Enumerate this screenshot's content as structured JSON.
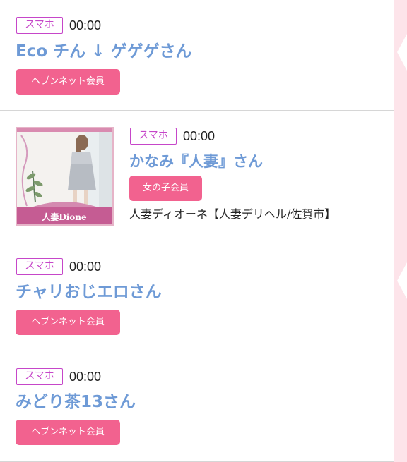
{
  "entries": [
    {
      "device": "スマホ",
      "time": "00:00",
      "name": "Eco チん ↓ ゲゲゲさん",
      "member_type": "ヘブンネット会員"
    },
    {
      "device": "スマホ",
      "time": "00:00",
      "name": "かなみ『人妻』さん",
      "member_type": "女の子会員",
      "shop": "人妻ディオーネ【人妻デリヘル/佐賀市】",
      "photo_caption": "人妻Dione"
    },
    {
      "device": "スマホ",
      "time": "00:00",
      "name": "チャリおじエロさん",
      "member_type": "ヘブンネット会員"
    },
    {
      "device": "スマホ",
      "time": "00:00",
      "name": "みどり茶13さん",
      "member_type": "ヘブンネット会員"
    }
  ],
  "colors": {
    "device_badge": "#c646c9",
    "name": "#6e9ad6",
    "member_badge": "#f2628f",
    "side_strip": "#fde4ea"
  }
}
